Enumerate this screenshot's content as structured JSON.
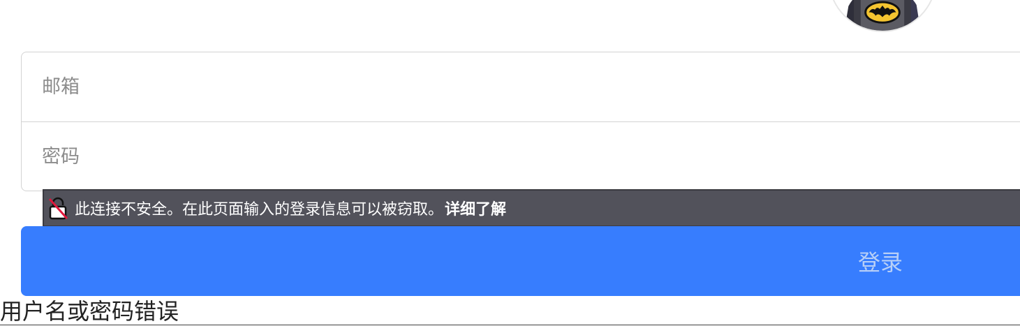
{
  "avatar": {
    "icon": "batman-avatar-icon"
  },
  "login_form": {
    "email_placeholder": "邮箱",
    "password_placeholder": "密码",
    "submit_label": "登录",
    "submit_color": "#377dfe"
  },
  "security_warning": {
    "message": "此连接不安全。在此页面输入的登录信息可以被窃取。",
    "learn_more": "详细了解",
    "icon": "insecure-lock-icon",
    "background": "#52525b"
  },
  "error": {
    "message": "用户名或密码错误"
  }
}
